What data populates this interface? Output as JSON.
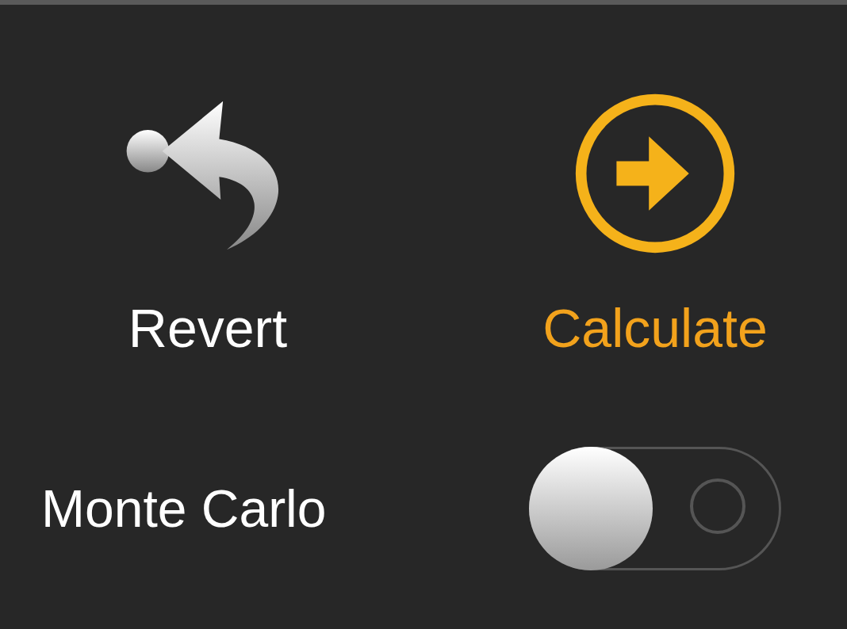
{
  "buttons": [
    {
      "kind": "revert",
      "label": "Revert"
    },
    {
      "kind": "calculate",
      "label": "Calculate"
    }
  ],
  "toggle": {
    "label": "Monte Carlo",
    "on": false
  }
}
